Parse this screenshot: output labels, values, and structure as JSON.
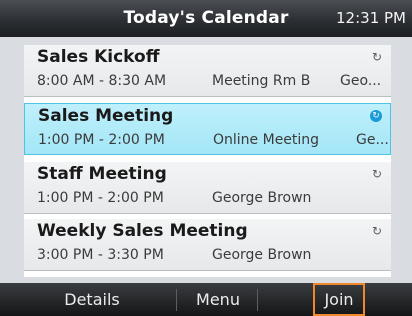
{
  "header": {
    "title": "Today's Calendar",
    "time": "12:31 PM"
  },
  "items": [
    {
      "name": "Sales Kickoff",
      "time": "8:00 AM - 8:30 AM",
      "location": "Meeting Rm B",
      "extra": "Geo...",
      "icon": "sync-icon"
    },
    {
      "name": "Sales Meeting",
      "time": "1:00 PM - 2:00 PM",
      "location": "Online Meeting",
      "extra": "Ge...",
      "icon": "online-meeting-icon"
    },
    {
      "name": "Staff Meeting",
      "time": "1:00 PM - 2:00 PM",
      "location": "George Brown",
      "extra": "",
      "icon": "sync-icon"
    },
    {
      "name": "Weekly Sales Meeting",
      "time": "3:00 PM - 3:30 PM",
      "location": "George Brown",
      "extra": "",
      "icon": "sync-icon"
    }
  ],
  "softkeys": {
    "details": "Details",
    "menu": "Menu",
    "join": "Join"
  },
  "colors": {
    "selected_bg": "#a4e6f7",
    "join_outline": "#f0892b"
  }
}
